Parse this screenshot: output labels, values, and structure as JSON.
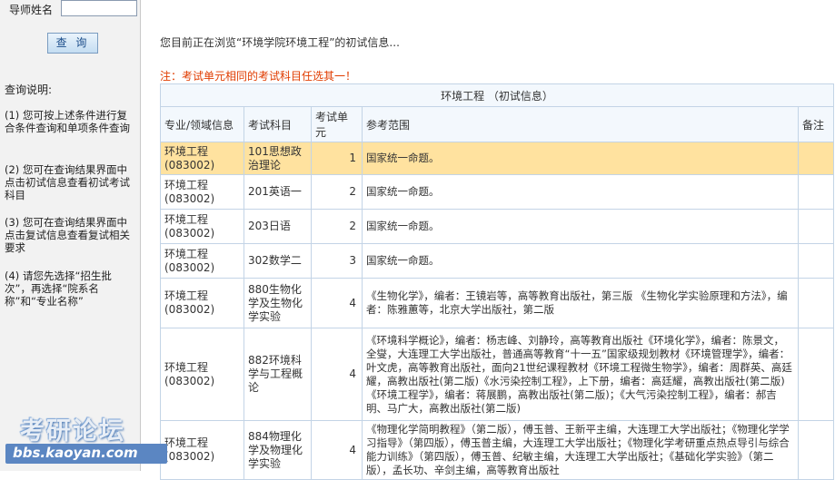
{
  "search": {
    "label": "导师姓名",
    "value": "",
    "button_label": "查 询"
  },
  "help": {
    "title": "查询说明:",
    "items": [
      "(1) 您可按上述条件进行复合条件查询和单项条件查询",
      "(2) 您可在查询结果界面中点击初试信息查看初试考试科目",
      "(3) 您可在查询结果界面中点击复试信息查看复试相关要求",
      "(4) 请您先选择“招生批次”，再选择“院系名称”和“专业名称”"
    ]
  },
  "main": {
    "browse_info": "您目前正在浏览“环境学院环境工程”的初试信息...",
    "note": "注：考试单元相同的考试科目任选其一！"
  },
  "table": {
    "caption": "环境工程 （初试信息）",
    "headers": [
      "专业/领域信息",
      "考试科目",
      "考试单元",
      "参考范围",
      "备注"
    ],
    "rows": [
      {
        "major": "环境工程",
        "code": "(083002)",
        "subject": "101思想政治理论",
        "unit": "1",
        "reference": "国家统一命题。",
        "remark": "",
        "highlight": true
      },
      {
        "major": "环境工程",
        "code": "(083002)",
        "subject": "201英语一",
        "unit": "2",
        "reference": "国家统一命题。",
        "remark": ""
      },
      {
        "major": "环境工程",
        "code": "(083002)",
        "subject": "203日语",
        "unit": "2",
        "reference": "国家统一命题。",
        "remark": ""
      },
      {
        "major": "环境工程",
        "code": "(083002)",
        "subject": "302数学二",
        "unit": "3",
        "reference": "国家统一命题。",
        "remark": ""
      },
      {
        "major": "环境工程",
        "code": "(083002)",
        "subject": "880生物化学及生物化学实验",
        "unit": "4",
        "reference": "《生物化学》，编者：王镜岩等，高等教育出版社，第三版 《生物化学实验原理和方法》，编者：陈雅蕙等，北京大学出版社，第二版",
        "remark": ""
      },
      {
        "major": "环境工程",
        "code": "(083002)",
        "subject": "882环境科学与工程概论",
        "unit": "4",
        "reference": "《环境科学概论》，编者：杨志峰、刘静玲，高等教育出版社《环境化学》，编者：陈景文，全燮，大连理工大学出版社，普通高等教育“十一五”国家级规划教材《环境管理学》，编者：叶文虎，高等教育出版社，面向21世纪课程教材《环境工程微生物学》，编者：周群英、高廷耀，高教出版社(第二版)《水污染控制工程》，上下册，编者：高廷耀，高教出版社(第二版)《环境工程学》，编者：蒋展鹏，高教出版社(第二版)；《大气污染控制工程》，编者：郝吉明、马广大，高教出版社(第二版)",
        "remark": ""
      },
      {
        "major": "环境工程",
        "code": "(083002)",
        "subject": "884物理化学及物理化学实验",
        "unit": "4",
        "reference": "《物理化学简明教程》（第二版），傅玉普、王新平主编，大连理工大学出版社；《物理化学学习指导》（第四版），傅玉普主编，大连理工大学出版社；《物理化学考研重点热点导引与综合能力训练》（第四版），傅玉普、纪敏主编，大连理工大学出版社；《基础化学实验》（第二版），孟长功、辛剑主编，高等教育出版社",
        "remark": ""
      }
    ]
  },
  "watermark": {
    "title": "考研论坛",
    "url": "bbs.kaoyan.com"
  }
}
